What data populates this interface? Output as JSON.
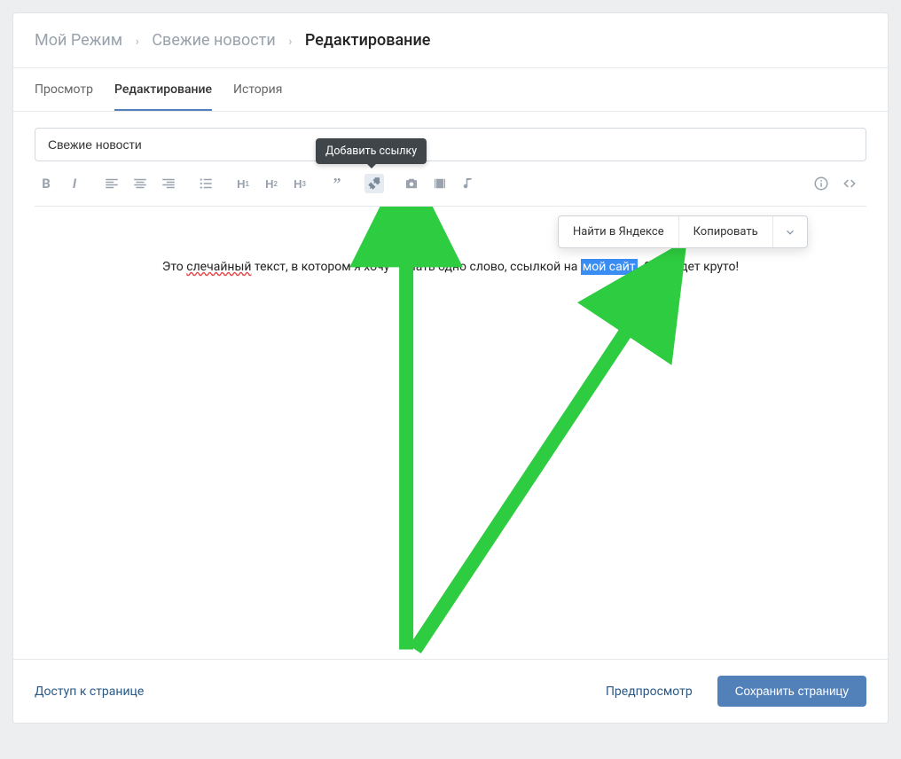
{
  "breadcrumb": {
    "a": "Мой Режим",
    "b": "Свежие новости",
    "c": "Редактирование"
  },
  "tabs": {
    "view": "Просмотр",
    "edit": "Редактирование",
    "history": "История"
  },
  "editor": {
    "title_value": "Свежие новости",
    "tooltip_link": "Добавить ссылку",
    "text_before": "Это ",
    "text_typo": "слечайный",
    "text_mid": " текст, в котором я хочу    елать одно слово, ссылкой на ",
    "text_sel": "мой сайт",
    "text_after": ". Это будет круто!"
  },
  "contextmenu": {
    "search": "Найти в Яндексе",
    "copy": "Копировать"
  },
  "footer": {
    "access": "Доступ к странице",
    "preview": "Предпросмотр",
    "save": "Сохранить страницу"
  }
}
